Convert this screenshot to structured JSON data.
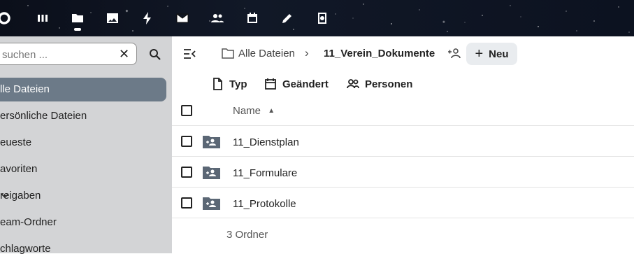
{
  "app": {
    "top_icons": [
      "logo-icon",
      "dashboard-icon",
      "files-icon",
      "photos-icon",
      "activity-icon",
      "mail-icon",
      "contacts-icon",
      "calendar-icon",
      "notes-icon",
      "deck-icon"
    ]
  },
  "sidebar": {
    "search_placeholder": "suchen ...",
    "items": [
      {
        "label": "lle Dateien",
        "active": true
      },
      {
        "label": "ersönliche Dateien"
      },
      {
        "label": "eueste"
      },
      {
        "label": "avoriten"
      },
      {
        "label": "reigaben",
        "expandable": true
      },
      {
        "label": "eam-Ordner"
      },
      {
        "label": "chlagworte"
      }
    ]
  },
  "breadcrumb": {
    "root": "Alle Dateien",
    "separator": "›",
    "current": "11_Verein_Dokumente"
  },
  "toolbar": {
    "new_label": "Neu",
    "new_prefix": "+"
  },
  "filters": {
    "type": "Typ",
    "modified": "Geändert",
    "people": "Personen"
  },
  "list": {
    "column_name": "Name",
    "sort_indicator": "▲",
    "rows": [
      {
        "name": "11_Dienstplan"
      },
      {
        "name": "11_Formulare"
      },
      {
        "name": "11_Protokolle"
      }
    ],
    "summary": "3 Ordner"
  },
  "colors": {
    "sidebar_bg": "#d3d4d6",
    "active_bg": "#6c7a88",
    "folder": "#5b6775"
  }
}
